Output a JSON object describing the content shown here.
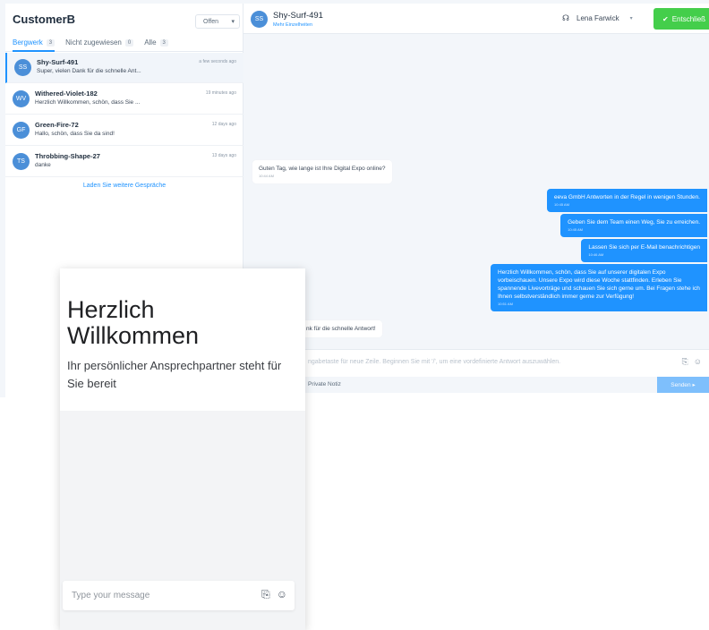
{
  "sidebar": {
    "title": "CustomerB",
    "status_filter": "Offen",
    "tabs": [
      {
        "label": "Bergwerk",
        "count": "3"
      },
      {
        "label": "Nicht zugewiesen",
        "count": "0"
      },
      {
        "label": "Alle",
        "count": "3"
      }
    ],
    "conversations": [
      {
        "initials": "SS",
        "name": "Shy-Surf-491",
        "preview": "Super, vielen Dank für die schnelle Ant...",
        "time": "a few seconds ago"
      },
      {
        "initials": "WV",
        "name": "Withered-Violet-182",
        "preview": "Herzlich Willkommen, schön, dass Sie ...",
        "time": "19 minutes ago"
      },
      {
        "initials": "GF",
        "name": "Green-Fire-72",
        "preview": "Hallo, schön, dass Sie da sind!",
        "time": "12 days ago"
      },
      {
        "initials": "TS",
        "name": "Throbbing-Shape-27",
        "preview": "danke",
        "time": "13 days ago"
      }
    ],
    "load_more": "Laden Sie weitere Gespräche"
  },
  "chat": {
    "contact_initials": "SS",
    "contact_name": "Shy-Surf-491",
    "more_details": "Mehr Einzelheiten",
    "agent": "Lena Farwick",
    "resolve_label": "Entschließ",
    "messages": [
      {
        "direction": "in",
        "text": "Guten Tag, wie lange ist Ihre Digital Expo online?",
        "time": "10:44 AM"
      },
      {
        "direction": "out",
        "text": "eeva GmbH Antworten in der Regel in wenigen Stunden.",
        "time": "10:45 AM"
      },
      {
        "direction": "out",
        "text": "Geben Sie dem Team einen Weg, Sie zu erreichen.",
        "time": "10:45 AM"
      },
      {
        "direction": "out",
        "text": "Lassen Sie sich per E-Mail benachrichtigen",
        "time": "10:46 AM"
      },
      {
        "direction": "out",
        "text": "Herzlich Willkommen, schön, dass Sie auf unserer digitalen Expo vorbeischauen. Unsere Expo wird diese Woche stattfinden. Erleben Sie spannende Livevorträge und schauen Sie sich gerne um. Bei Fragen stehe ich Ihnen selbstverständlich immer gerne zur Verfügung!",
        "time": "10:51 AM"
      },
      {
        "direction": "in",
        "text": "nk für die schnelle Antwort!",
        "time": ""
      }
    ],
    "reply_placeholder": "ngabetaste für neue Zeile. Beginnen Sie mit '/', um eine vordefinierte Antwort auszuwählen.",
    "private_note": "Private Notiz",
    "send_label": "Senden"
  },
  "widget": {
    "title": "Herzlich Willkommen",
    "subtitle": "Ihr persönlicher Ansprechpartner steht für Sie bereit",
    "input_placeholder": "Type your message"
  },
  "colors": {
    "accent": "#1f93ff",
    "resolve": "#44ce4b",
    "avatar": "#4b8fd8",
    "app_bg": "#f3f6fa"
  },
  "icons": [
    "chevron-down-icon",
    "headset-icon",
    "check-icon",
    "paperclip-icon",
    "emoji-icon",
    "send-arrow-icon"
  ]
}
